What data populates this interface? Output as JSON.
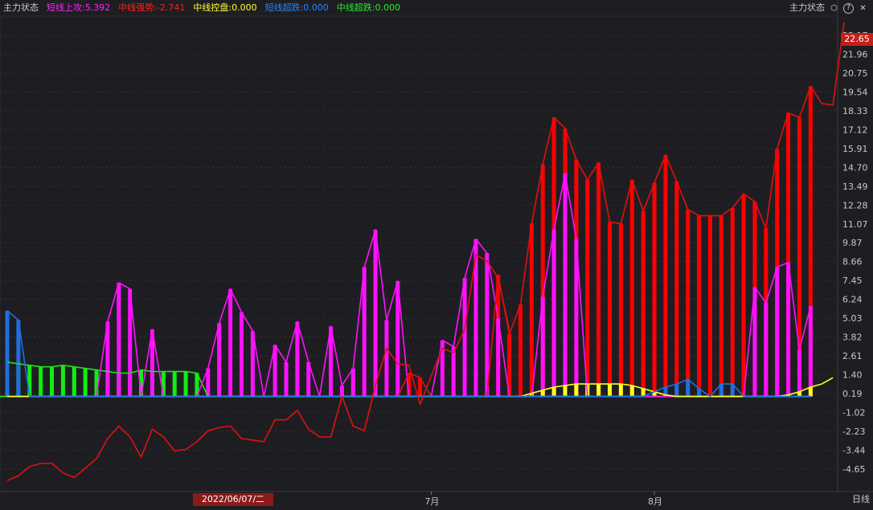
{
  "indicator": {
    "name": "主力状态",
    "legend": [
      {
        "text": "短线上攻:5.392",
        "color": "#ff22ff"
      },
      {
        "text": "中线强势:-2.741",
        "color": "#ff2020"
      },
      {
        "text": "中线控盘:0.000",
        "color": "#ffff33"
      },
      {
        "text": "短线超跌:0.000",
        "color": "#2288ff"
      },
      {
        "text": "中线超跌:0.000",
        "color": "#22ee22"
      }
    ]
  },
  "toolbar": {
    "title": "主力状态",
    "settings_icon": "hexagon-settings-icon",
    "help_icon": "question-icon",
    "close_icon": "close-icon"
  },
  "last_value": "22.65",
  "cursor_date": "2022/06/07/二",
  "period_label": "日线",
  "chart_data": {
    "type": "bar",
    "y_ticks": [
      "23.17",
      "21.96",
      "20.75",
      "19.54",
      "18.33",
      "17.12",
      "15.91",
      "14.70",
      "13.49",
      "12.28",
      "11.07",
      "9.87",
      "8.66",
      "7.45",
      "6.24",
      "5.03",
      "3.82",
      "2.61",
      "1.40",
      "0.19",
      "-1.02",
      "-2.23",
      "-3.44",
      "-4.65"
    ],
    "ylim": [
      -6.0,
      24.0
    ],
    "x_labels": [
      {
        "text": "7月",
        "index": 38
      },
      {
        "text": "8月",
        "index": 58
      }
    ],
    "n": 73,
    "colors": {
      "magenta": "#ff11ff",
      "red": "#ff0000",
      "yellow": "#ffff22",
      "blue": "#1e6fe0",
      "green": "#11ee11",
      "redline": "#e01010",
      "greenline": "#22dd22"
    },
    "series": [
      {
        "name": "短线上攻",
        "values": [
          0,
          0,
          0,
          0,
          0,
          0,
          0,
          0,
          0,
          4.8,
          7.3,
          6.9,
          0,
          4.3,
          0,
          0,
          0,
          0,
          1.8,
          4.7,
          6.9,
          5.4,
          4.2,
          0,
          3.3,
          2.2,
          4.8,
          2.2,
          0,
          4.5,
          0.7,
          1.8,
          8.3,
          10.7,
          4.9,
          7.4,
          0,
          0,
          0,
          3.6,
          3.2,
          7.6,
          10.1,
          9.2,
          5.0,
          0,
          0,
          0,
          6.4,
          10.7,
          14.3,
          10.1,
          0,
          0,
          0,
          0,
          0,
          0,
          0,
          0,
          0,
          0,
          0,
          0,
          0,
          0,
          0,
          7.0,
          6.0,
          8.3,
          8.6,
          3.0,
          5.8
        ]
      },
      {
        "name": "中线强势",
        "values": [
          0,
          0,
          0,
          0,
          0,
          0,
          0,
          0,
          0,
          0,
          0,
          0,
          0,
          0,
          0,
          0,
          0,
          0,
          0,
          0,
          0,
          0,
          0,
          0,
          0,
          0,
          0,
          0,
          0,
          0,
          0,
          0,
          0,
          0,
          0,
          0,
          1.5,
          1.2,
          0,
          0,
          0,
          0,
          0,
          0,
          7.8,
          4.0,
          5.9,
          11.1,
          14.9,
          17.9,
          17.2,
          15.2,
          13.9,
          15.0,
          11.2,
          11.1,
          13.9,
          11.9,
          13.7,
          15.5,
          13.8,
          12.0,
          11.6,
          11.6,
          11.6,
          12.1,
          13.0,
          12.5,
          10.8,
          15.9,
          18.2,
          17.9,
          19.9,
          18.8,
          18.7,
          24.0
        ]
      },
      {
        "name": "中线控盘",
        "values": [
          0,
          0,
          0,
          0,
          0,
          0,
          0,
          0,
          0,
          0,
          0,
          0,
          0,
          0,
          0,
          0,
          0,
          0,
          0,
          0,
          0,
          0,
          0,
          0,
          0,
          0,
          0,
          0,
          0,
          0,
          0,
          0,
          0,
          0,
          0,
          0,
          0,
          0,
          0,
          0,
          0,
          0,
          0,
          0,
          0,
          0,
          0,
          0.2,
          0.4,
          0.6,
          0.7,
          0.8,
          0.8,
          0.8,
          0.8,
          0.8,
          0.7,
          0.5,
          0.3,
          0.1,
          0,
          0,
          0,
          0,
          0,
          0,
          0,
          0,
          0,
          0,
          0.1,
          0.3,
          0.6,
          0.8,
          1.2
        ]
      },
      {
        "name": "短线超跌",
        "values": [
          5.5,
          4.9,
          0,
          0,
          0,
          0,
          0,
          0,
          0,
          0,
          0,
          0,
          0,
          0,
          0,
          0,
          0,
          0,
          0,
          0,
          0,
          0,
          0,
          0,
          0,
          0,
          0,
          0,
          0,
          0,
          0,
          0,
          0,
          0,
          0,
          0,
          0,
          0,
          0,
          0,
          0,
          0,
          0,
          0,
          0,
          0,
          0,
          0,
          0,
          0,
          0,
          0,
          0,
          0,
          0,
          0,
          0,
          0,
          0.3,
          0.6,
          0.8,
          1.1,
          0.5,
          0,
          0.8,
          0.8,
          0,
          0,
          0,
          0,
          0,
          0,
          0
        ]
      },
      {
        "name": "中线超跌",
        "values": [
          2.2,
          2.1,
          2.0,
          1.9,
          1.9,
          2.0,
          1.9,
          1.8,
          1.7,
          1.6,
          1.5,
          1.5,
          1.7,
          1.6,
          1.6,
          1.6,
          1.6,
          1.5,
          0,
          0,
          0,
          0,
          0,
          0,
          0,
          0,
          0,
          0,
          0,
          0,
          0,
          0,
          0,
          0,
          0,
          0,
          0,
          0,
          0,
          0,
          0,
          0,
          0,
          0,
          0,
          0,
          0,
          0,
          0,
          0,
          0,
          0,
          0,
          0,
          0,
          0,
          0,
          0,
          0,
          0,
          0,
          0,
          0,
          0,
          0,
          0,
          0,
          0,
          0,
          0,
          0,
          0,
          0
        ]
      },
      {
        "name": "红线",
        "values": [
          -5.4,
          -5.1,
          -4.5,
          -4.3,
          -4.3,
          -4.9,
          -5.2,
          -4.6,
          -4.0,
          -2.7,
          -1.9,
          -2.6,
          -3.9,
          -2.1,
          -2.6,
          -3.5,
          -3.4,
          -2.9,
          -2.2,
          -2.0,
          -1.9,
          -2.7,
          -2.8,
          -2.9,
          -1.5,
          -1.5,
          -0.9,
          -2.1,
          -2.6,
          -2.6,
          0,
          -1.9,
          -2.2,
          0.7,
          3.1,
          2.1,
          2.0,
          -0.5,
          1.3,
          3.1,
          2.8,
          4.3,
          9.1,
          8.7,
          7.6,
          4.3
        ]
      }
    ]
  }
}
